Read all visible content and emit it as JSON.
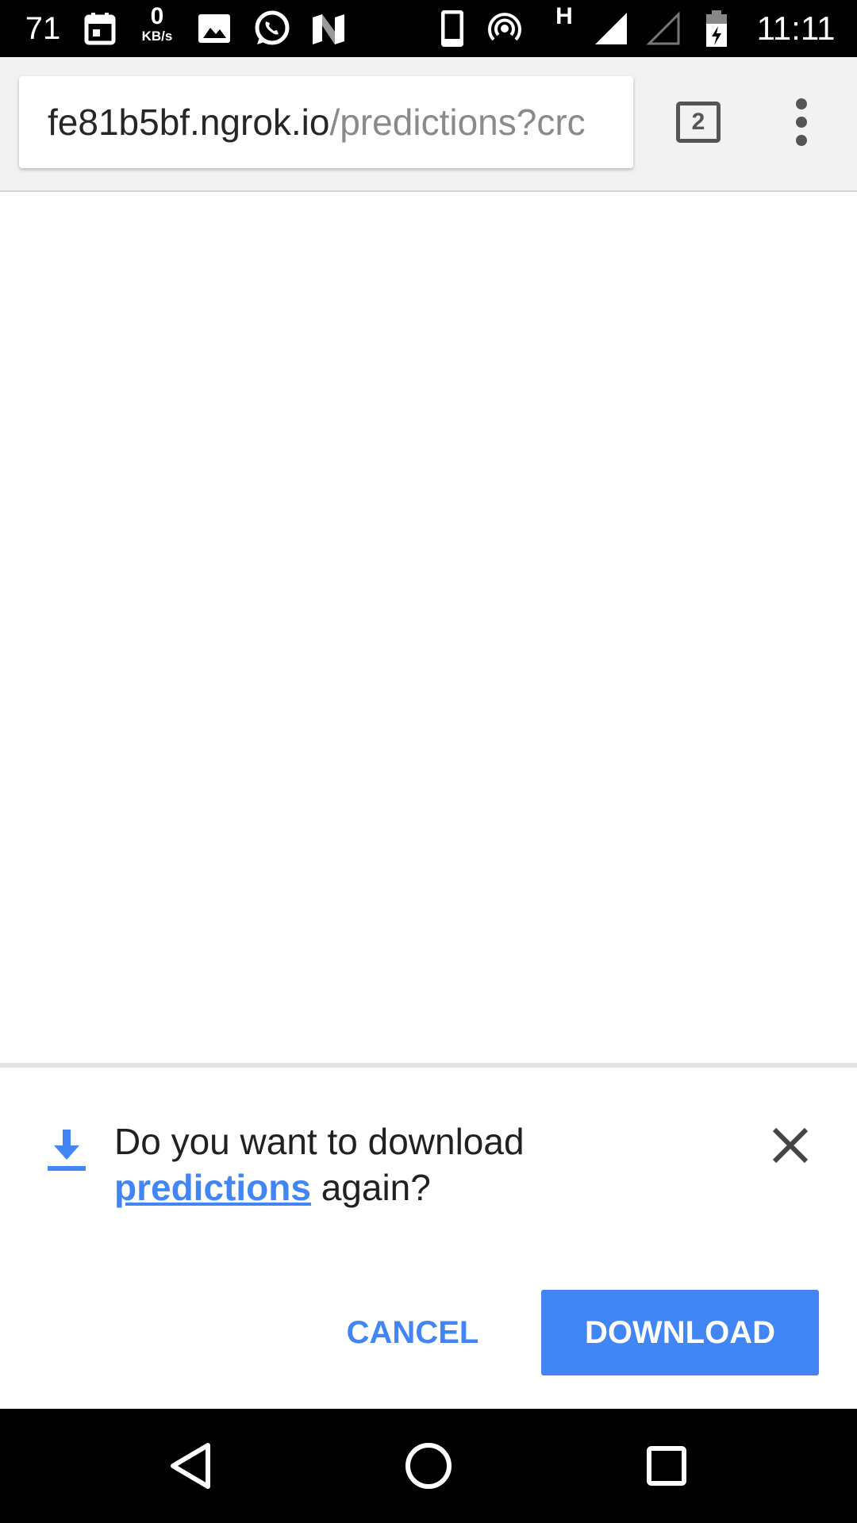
{
  "status_bar": {
    "battery_percent_text": "71",
    "net_speed_value": "0",
    "net_speed_unit": "KB/s",
    "network_type": "H",
    "time": "11:11",
    "icons": [
      "calendar-icon",
      "gallery-icon",
      "whatsapp-icon",
      "n-icon",
      "phone-icon",
      "hotspot-icon",
      "signal-icon",
      "signal-empty-icon",
      "battery-charging-icon"
    ]
  },
  "toolbar": {
    "url_host": "fe81b5bf.ngrok.io",
    "url_path": "/predictions?crc",
    "tab_count": "2"
  },
  "infobar": {
    "message_prefix": "Do you want to download",
    "file_link": "predictions",
    "message_suffix": " again?",
    "cancel_label": "CANCEL",
    "download_label": "DOWNLOAD",
    "accent_color": "#4285f4"
  },
  "navbar": {
    "buttons": [
      "back-icon",
      "home-icon",
      "recents-icon"
    ]
  }
}
